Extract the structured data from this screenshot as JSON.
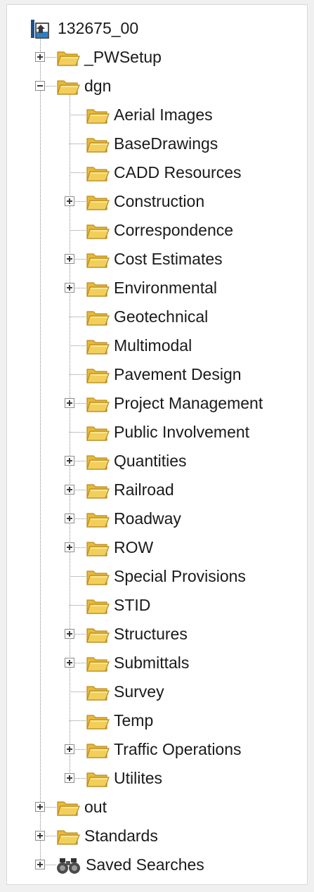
{
  "tree": {
    "root": "132675_00",
    "top_level": [
      {
        "label": "_PWSetup",
        "state": "collapsed"
      },
      {
        "label": "dgn",
        "state": "expanded"
      },
      {
        "label": "out",
        "state": "collapsed"
      },
      {
        "label": "Standards",
        "state": "collapsed"
      },
      {
        "label": "Saved Searches",
        "state": "collapsed",
        "icon": "binoculars-icon"
      }
    ],
    "dgn_children": [
      {
        "label": "Aerial Images",
        "expandable": false
      },
      {
        "label": "BaseDrawings",
        "expandable": false
      },
      {
        "label": "CADD Resources",
        "expandable": false
      },
      {
        "label": "Construction",
        "expandable": true
      },
      {
        "label": "Correspondence",
        "expandable": false
      },
      {
        "label": "Cost Estimates",
        "expandable": true
      },
      {
        "label": "Environmental",
        "expandable": true
      },
      {
        "label": "Geotechnical",
        "expandable": false
      },
      {
        "label": "Multimodal",
        "expandable": false
      },
      {
        "label": "Pavement Design",
        "expandable": false
      },
      {
        "label": "Project Management",
        "expandable": true
      },
      {
        "label": "Public Involvement",
        "expandable": false
      },
      {
        "label": "Quantities",
        "expandable": true
      },
      {
        "label": "Railroad",
        "expandable": true
      },
      {
        "label": "Roadway",
        "expandable": true
      },
      {
        "label": "ROW",
        "expandable": true
      },
      {
        "label": "Special Provisions",
        "expandable": false
      },
      {
        "label": "STID",
        "expandable": false
      },
      {
        "label": "Structures",
        "expandable": true
      },
      {
        "label": "Submittals",
        "expandable": true
      },
      {
        "label": "Survey",
        "expandable": false
      },
      {
        "label": "Temp",
        "expandable": false
      },
      {
        "label": "Traffic Operations",
        "expandable": true
      },
      {
        "label": "Utilites",
        "expandable": true
      }
    ]
  },
  "colors": {
    "folder_fill": "#f2cf5b",
    "folder_stroke": "#b98a1c",
    "folder_tab": "#e7b93b",
    "text": "#1a1a1a",
    "connector": "#8a8a8a"
  }
}
